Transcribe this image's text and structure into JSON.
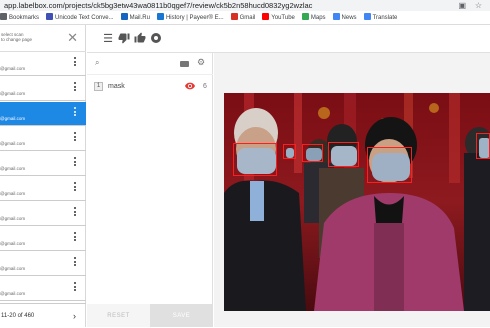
{
  "browser": {
    "url": "app.labelbox.com/projects/ck5bg3etw43wa0811b0qgef7/review/ck5b2n58hucd0832yg2wzlac",
    "bookmarks": [
      {
        "label": "Bookmarks",
        "icon": "bookmarks-icon",
        "color": "#5f6368"
      },
      {
        "label": "Unicode Text Conve...",
        "icon": "unicode-icon",
        "color": "#3f51b5"
      },
      {
        "label": "Mail.Ru",
        "icon": "mail-icon",
        "color": "#1565c0"
      },
      {
        "label": "History | Payeer® E...",
        "icon": "payeer-icon",
        "color": "#1976d2"
      },
      {
        "label": "Gmail",
        "icon": "gmail-icon",
        "color": "#d93025"
      },
      {
        "label": "YouTube",
        "icon": "youtube-icon",
        "color": "#ff0000"
      },
      {
        "label": "Maps",
        "icon": "maps-icon",
        "color": "#34a853"
      },
      {
        "label": "News",
        "icon": "news-icon",
        "color": "#4285f4"
      },
      {
        "label": "Translate",
        "icon": "translate-icon",
        "color": "#4285f4"
      }
    ]
  },
  "leftpanel": {
    "header_line1": "select scan",
    "header_line2": "to change page",
    "items": [
      {
        "email": "@gmail.com",
        "selected": false
      },
      {
        "email": "@gmail.com",
        "selected": false
      },
      {
        "email": "@gmail.com",
        "selected": true
      },
      {
        "email": "@gmail.com",
        "selected": false
      },
      {
        "email": "@gmail.com",
        "selected": false
      },
      {
        "email": "@gmail.com",
        "selected": false
      },
      {
        "email": "@gmail.com",
        "selected": false
      },
      {
        "email": "@gmail.com",
        "selected": false
      },
      {
        "email": "@gmail.com",
        "selected": false
      },
      {
        "email": "@gmail.com",
        "selected": false
      }
    ],
    "pager": "11-20 of 460"
  },
  "objects": {
    "items": [
      {
        "key": "1",
        "name": "mask",
        "count": "6"
      }
    ]
  },
  "buttons": {
    "reset": "RESET",
    "save": "SAVE"
  },
  "colors": {
    "accent": "#1e88e5",
    "bbox": "#ff1e1e"
  }
}
